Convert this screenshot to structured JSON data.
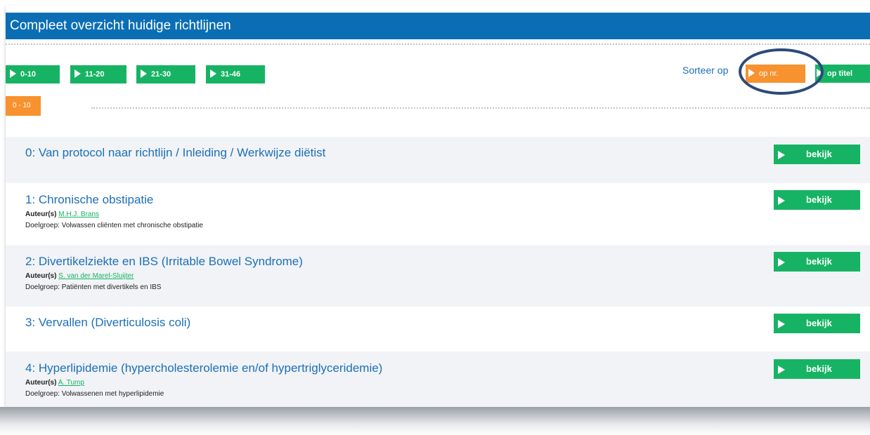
{
  "header": {
    "title": "Compleet overzicht huidige richtlijnen"
  },
  "range_buttons": [
    {
      "label": "0-10"
    },
    {
      "label": "11-20"
    },
    {
      "label": "21-30"
    },
    {
      "label": "31-46"
    }
  ],
  "sort": {
    "label": "Sorteer op",
    "by_number": "op nr.",
    "by_title": "op titel"
  },
  "current_range": "0 - 10",
  "rows": [
    {
      "title": "0: Van protocol naar richtlijn / Inleiding / Werkwijze diëtist",
      "action": "bekijk"
    },
    {
      "title": "1: Chronische obstipatie",
      "author_label": "Auteur(s)",
      "author": "M.H.J. Brans",
      "target": "Doelgroep: Volwassen cliënten met chronische obstipatie",
      "action": "bekijk"
    },
    {
      "title": "2: Divertikelziekte en IBS (Irritable Bowel Syndrome)",
      "author_label": "Auteur(s)",
      "author": "S. van der Marel-Sluijter",
      "target": "Doelgroep: Patiënten met divertikels en IBS",
      "action": "bekijk"
    },
    {
      "title": "3: Vervallen (Diverticulosis coli)",
      "action": "bekijk"
    },
    {
      "title": "4: Hyperlipidemie (hypercholesterolemie en/of hypertriglyceridemie)",
      "author_label": "Auteur(s)",
      "author": "A. Tump",
      "target": "Doelgroep: Volwassenen met hyperlipidemie",
      "action": "bekijk"
    }
  ],
  "colors": {
    "header_blue": "#0b6eb5",
    "link_blue": "#1d6fb8",
    "green": "#17b364",
    "orange": "#f7922e",
    "highlight_circle": "#2b4a7a"
  },
  "icons": [
    "play-triangle-icon"
  ]
}
